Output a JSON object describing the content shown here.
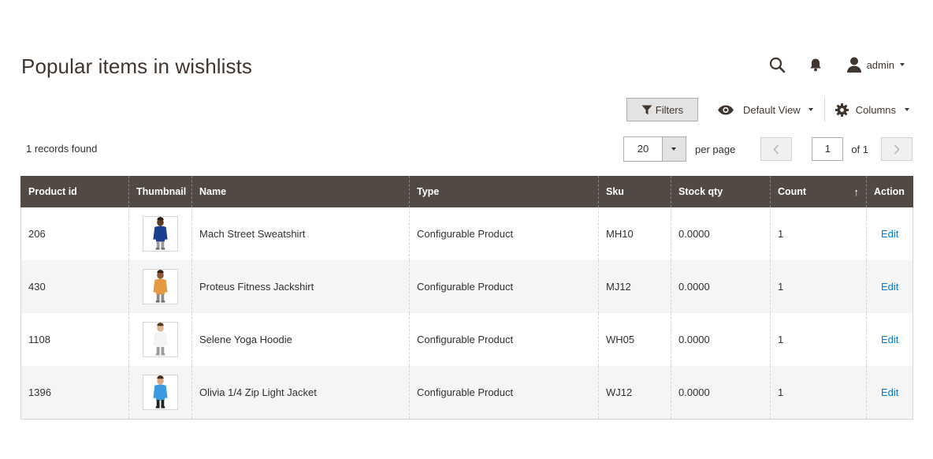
{
  "page": {
    "title": "Popular items in wishlists"
  },
  "header": {
    "user_name": "admin"
  },
  "toolbar": {
    "filters_label": "Filters",
    "view_label": "Default View",
    "columns_label": "Columns"
  },
  "grid": {
    "records_text": "1 records found",
    "per_page_value": "20",
    "per_page_label": "per page",
    "current_page": "1",
    "page_total_text": "of 1",
    "columns": [
      "Product id",
      "Thumbnail",
      "Name",
      "Type",
      "Sku",
      "Stock qty",
      "Count",
      "Action"
    ],
    "sorted_column_arrow": "↑",
    "rows": [
      {
        "product_id": "206",
        "thumb": {
          "shirt": "#1b3f8f",
          "skin": "#5a3a26",
          "pants": "#9a9a9a",
          "shoes": "#6b6b6b",
          "hair": "#2a1a10"
        },
        "name": "Mach Street Sweatshirt",
        "type": "Configurable Product",
        "sku": "MH10",
        "stock_qty": "0.0000",
        "count": "1",
        "action": "Edit"
      },
      {
        "product_id": "430",
        "thumb": {
          "shirt": "#e39a42",
          "skin": "#8a5a3a",
          "pants": "#8c8c8c",
          "shoes": "#6b6b6b",
          "hair": "#3a2414"
        },
        "name": "Proteus Fitness Jackshirt",
        "type": "Configurable Product",
        "sku": "MJ12",
        "stock_qty": "0.0000",
        "count": "1",
        "action": "Edit"
      },
      {
        "product_id": "1108",
        "thumb": {
          "shirt": "#f4f4f4",
          "skin": "#e0b592",
          "pants": "#9d9d9d",
          "shoes": "#9d9d9d",
          "hair": "#5a3a20"
        },
        "name": "Selene Yoga Hoodie",
        "type": "Configurable Product",
        "sku": "WH05",
        "stock_qty": "0.0000",
        "count": "1",
        "action": "Edit"
      },
      {
        "product_id": "1396",
        "thumb": {
          "shirt": "#3a9be0",
          "skin": "#d9a880",
          "pants": "#222222",
          "shoes": "#222222",
          "hair": "#4a2e18"
        },
        "name": "Olivia 1/4 Zip Light Jacket",
        "type": "Configurable Product",
        "sku": "WJ12",
        "stock_qty": "0.0000",
        "count": "1",
        "action": "Edit"
      }
    ]
  }
}
